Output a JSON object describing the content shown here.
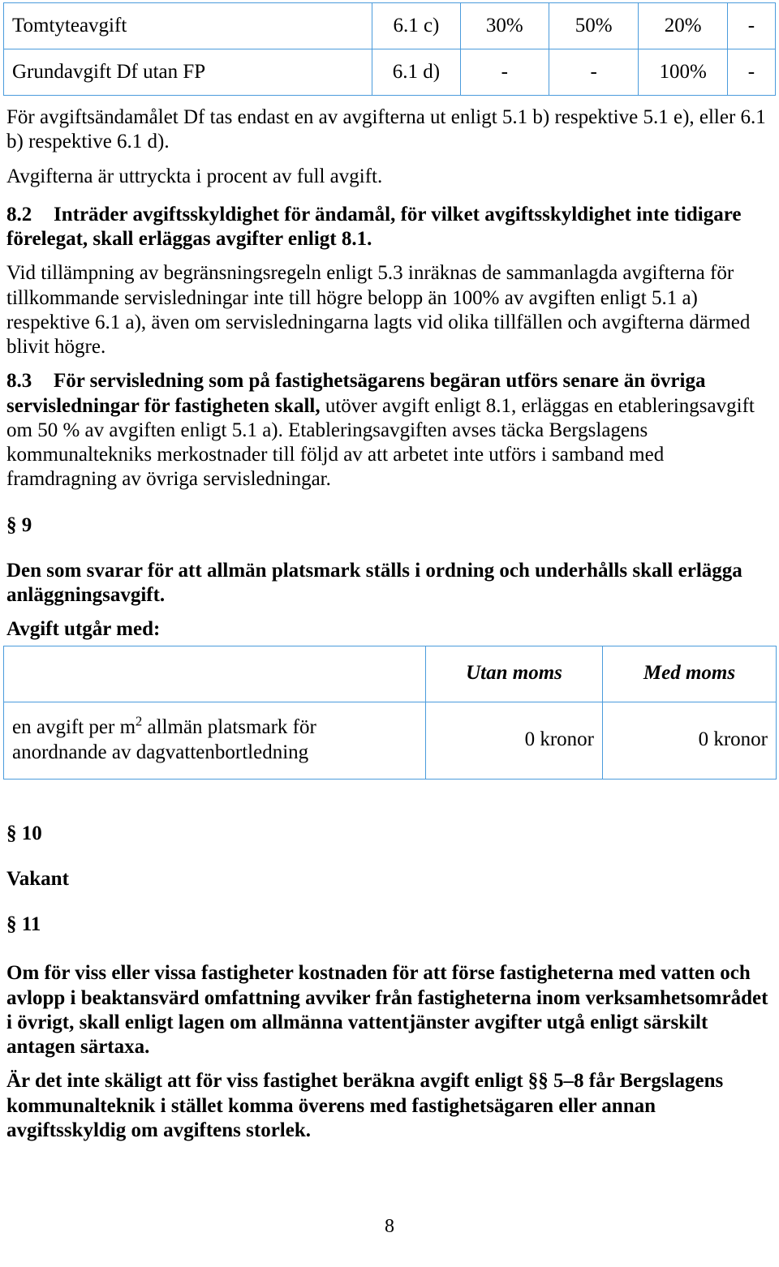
{
  "document": {
    "page_number": "8",
    "table_border_color": "#4A9BDC"
  },
  "fee_matrix_table": {
    "rows": [
      {
        "label": "Tomtyteavgift",
        "ref": "6.1 c)",
        "c1": "30%",
        "c2": "50%",
        "c3": "20%",
        "c4": "-"
      },
      {
        "label": "Grundavgift Df utan FP",
        "ref": "6.1 d)",
        "c1": "-",
        "c2": "-",
        "c3": "100%",
        "c4": "-"
      }
    ]
  },
  "notes": {
    "note1": "För avgiftsändamålet Df tas endast en av avgifterna ut enligt 5.1 b) respektive 5.1 e), eller 6.1 b) respektive 6.1 d).",
    "note2": "Avgifterna är uttryckta i procent av full avgift."
  },
  "clause_8_2": {
    "number": "8.2",
    "bold_text": "Inträder avgiftsskyldighet för ändamål, för vilket avgiftsskyldighet inte tidigare förelegat, skall erläggas avgifter enligt 8.1.",
    "body": "Vid tillämpning av begränsningsregeln enligt 5.3 inräknas de sammanlagda avgifterna för tillkommande servisledningar inte till högre belopp än 100% av avgiften enligt 5.1 a) respektive 6.1 a), även om servisledningarna lagts vid olika tillfällen och avgifterna därmed blivit högre."
  },
  "clause_8_3": {
    "number": "8.3",
    "bold_text": "För servisledning som på fastighetsägarens begäran utförs senare än övriga servisledningar för fastigheten skall,",
    "rest_text": " utöver avgift enligt 8.1, erläggas en etableringsavgift om 50 %  av avgiften enligt 5.1 a). Etableringsavgiften avses täcka Bergslagens kommunaltekniks merkostnader till följd av att arbetet inte utförs i samband med framdragning av övriga servisledningar."
  },
  "section_9": {
    "heading": "§ 9",
    "paragraph": "Den som svarar för att allmän platsmark ställs i ordning och underhålls skall erlägga anläggningsavgift.",
    "fee_intro": "Avgift utgår med:"
  },
  "platsmark_table": {
    "headers": {
      "col1": "",
      "col2": "Utan moms",
      "col3": "Med moms"
    },
    "rows": [
      {
        "description_line1": "en avgift per m",
        "description_superscript": "2",
        "description_line1_tail": " allmän platsmark för",
        "description_line2": "anordnande av dagvattenbortledning",
        "without_vat": "0 kronor",
        "with_vat": "0 kronor"
      }
    ]
  },
  "section_10": {
    "heading": "§ 10",
    "body": "Vakant"
  },
  "section_11": {
    "heading": "§ 11",
    "paragraph1": "Om för viss eller vissa fastigheter kostnaden för att förse fastigheterna med vatten och avlopp i beaktansvärd omfattning avviker från fastigheterna inom verksamhetsområdet i övrigt, skall enligt lagen om allmänna vattentjänster avgifter utgå enligt särskilt antagen särtaxa.",
    "paragraph2": "Är det inte skäligt att för viss fastighet beräkna avgift enligt §§ 5–8 får Bergslagens kommunalteknik i stället komma överens med fastighetsägaren eller annan avgiftsskyldig om avgiftens storlek."
  }
}
